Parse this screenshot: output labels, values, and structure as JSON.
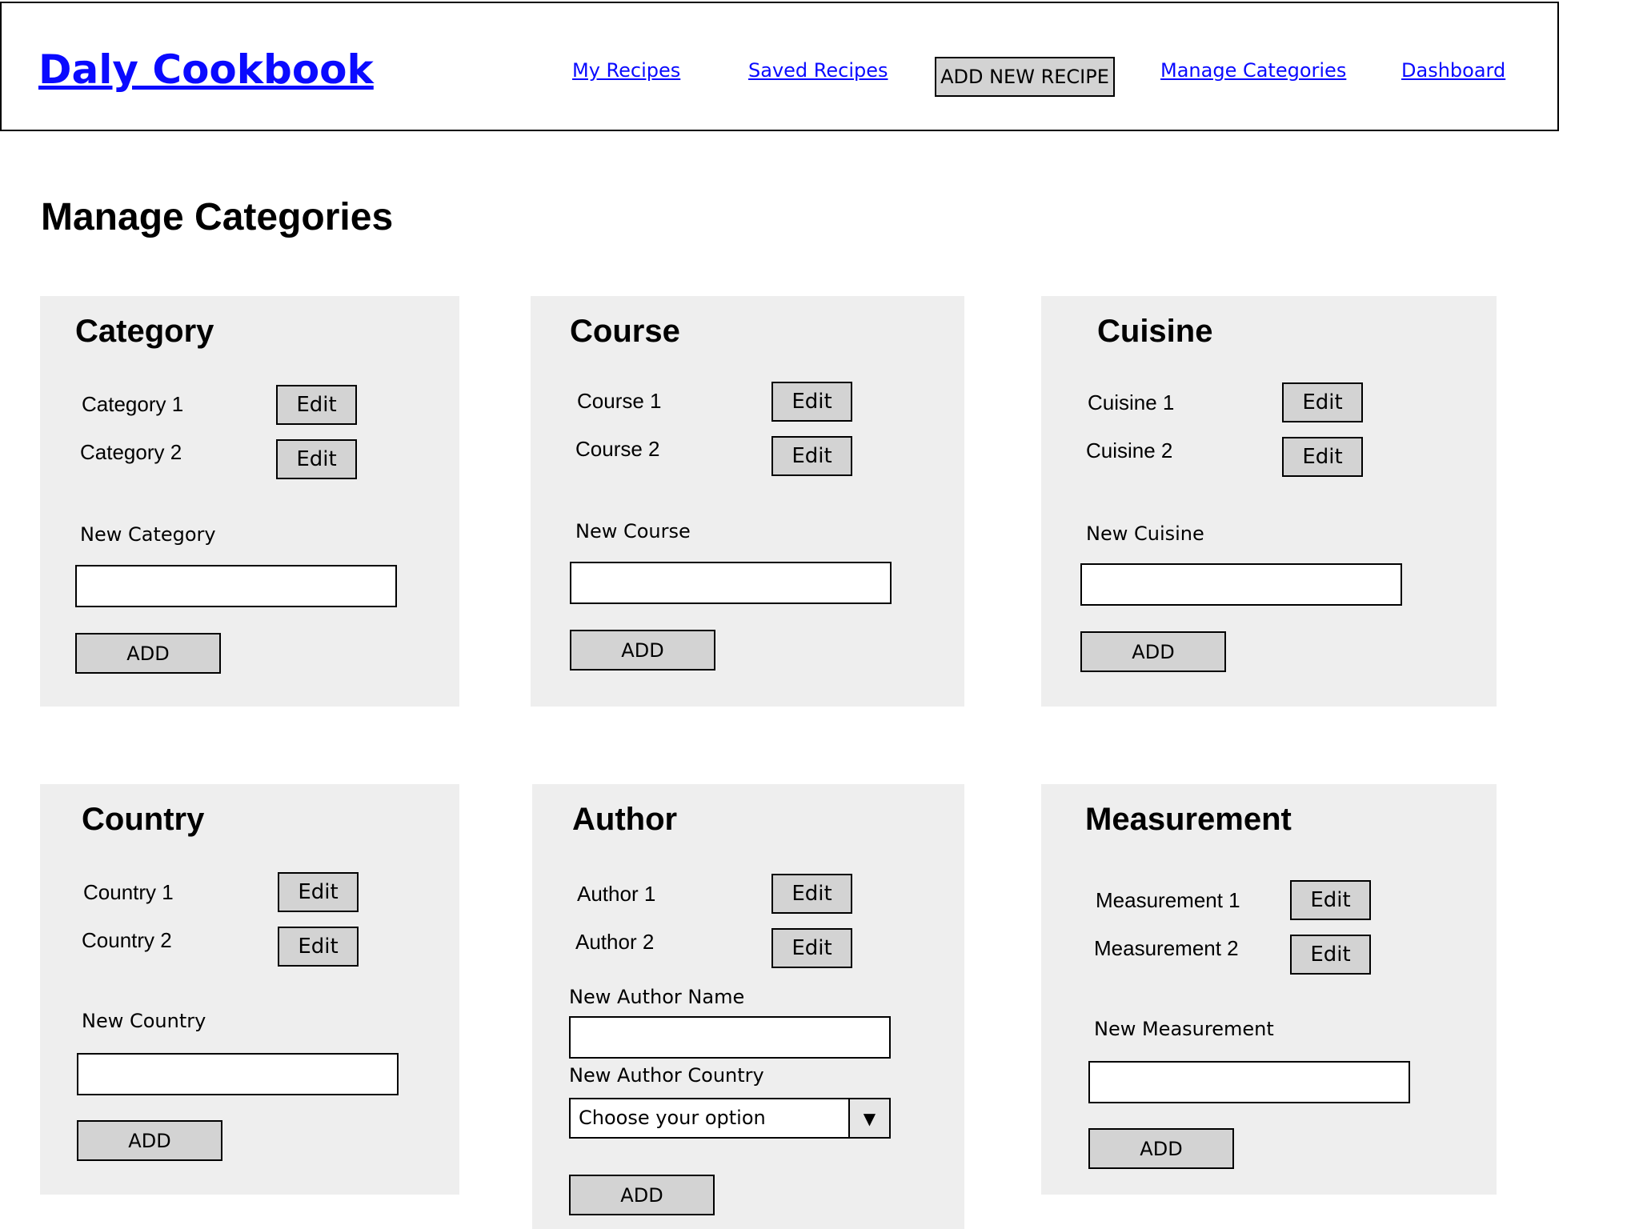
{
  "header": {
    "brand": "Daly Cookbook",
    "nav": {
      "my_recipes": "My Recipes",
      "saved_recipes": "Saved Recipes",
      "add_new_recipe": "ADD NEW RECIPE",
      "manage_categories": "Manage Categories",
      "dashboard": "Dashboard"
    }
  },
  "page_title": "Manage Categories",
  "cards": {
    "category": {
      "title": "Category",
      "items": [
        {
          "label": "Category 1",
          "edit": "Edit"
        },
        {
          "label": "Category 2",
          "edit": "Edit"
        }
      ],
      "new_label": "New Category",
      "input_value": "",
      "add": "ADD"
    },
    "course": {
      "title": "Course",
      "items": [
        {
          "label": "Course 1",
          "edit": "Edit"
        },
        {
          "label": "Course 2",
          "edit": "Edit"
        }
      ],
      "new_label": "New Course",
      "input_value": "",
      "add": "ADD"
    },
    "cuisine": {
      "title": "Cuisine",
      "items": [
        {
          "label": "Cuisine 1",
          "edit": "Edit"
        },
        {
          "label": "Cuisine 2",
          "edit": "Edit"
        }
      ],
      "new_label": "New Cuisine",
      "input_value": "",
      "add": "ADD"
    },
    "country": {
      "title": "Country",
      "items": [
        {
          "label": "Country 1",
          "edit": "Edit"
        },
        {
          "label": "Country 2",
          "edit": "Edit"
        }
      ],
      "new_label": "New Country",
      "input_value": "",
      "add": "ADD"
    },
    "author": {
      "title": "Author",
      "items": [
        {
          "label": "Author 1",
          "edit": "Edit"
        },
        {
          "label": "Author 2",
          "edit": "Edit"
        }
      ],
      "name_label": "New Author Name",
      "name_value": "",
      "country_label": "New Author Country",
      "country_selected": "Choose your option",
      "add": "ADD"
    },
    "measurement": {
      "title": "Measurement",
      "items": [
        {
          "label": "Measurement 1",
          "edit": "Edit"
        },
        {
          "label": "Measurement 2",
          "edit": "Edit"
        }
      ],
      "new_label": "New Measurement",
      "input_value": "",
      "add": "ADD"
    }
  },
  "icons": {
    "dropdown_arrow": "▼"
  }
}
